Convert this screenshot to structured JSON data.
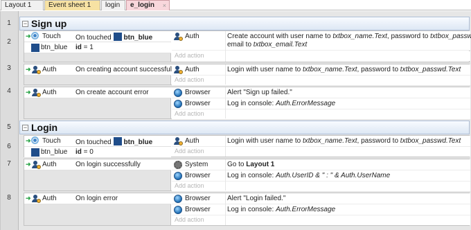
{
  "tabs": [
    {
      "label": "Layout 1"
    },
    {
      "label": "Event sheet 1"
    },
    {
      "label": "login"
    },
    {
      "label": "e_login",
      "close": "×"
    }
  ],
  "row_numbers": [
    "1",
    "2",
    "3",
    "4",
    "5",
    "6",
    "7",
    "8"
  ],
  "groups": [
    {
      "title": "Sign up",
      "toggle": "−"
    },
    {
      "title": "Login",
      "toggle": "−"
    }
  ],
  "common": {
    "add_action": "Add action",
    "on_touched": "On touched",
    "btn_blue": "btn_blue",
    "id_label": "id",
    "id_eq_1": "= 1",
    "id_eq_0": "= 0",
    "auth": "Auth",
    "browser": "Browser",
    "system": "System",
    "touch": "Touch"
  },
  "events": {
    "e2": {
      "cond2_obj": "btn_blue",
      "action": {
        "p1": "Create account with user name to ",
        "v1": "txtbox_name.Text",
        "p2": ", password to ",
        "v2": "txtbox_passwd.Text",
        "p3": ",",
        "p4": "email to ",
        "v3": "txtbox_email.Text"
      }
    },
    "e3": {
      "cond": "On creating account successfully",
      "action": {
        "p1": "Login with user name to ",
        "v1": "txtbox_name.Text",
        "p2": ", password to ",
        "v2": "txtbox_passwd.Text"
      }
    },
    "e4": {
      "cond": "On create account error",
      "a1": "Alert \"Sign up failed.\"",
      "a2_p": "Log in console: ",
      "a2_v": "Auth.ErrorMessage"
    },
    "e6": {
      "action": {
        "p1": "Login with user name to ",
        "v1": "txtbox_name.Text",
        "p2": ", password to ",
        "v2": "txtbox_passwd.Text"
      }
    },
    "e7": {
      "cond": "On login successfully",
      "a1_p": "Go to ",
      "a1_v": "Layout 1",
      "a2_p": "Log in console: ",
      "a2_v": "Auth.UserID & \" : \" & Auth.UserName"
    },
    "e8": {
      "cond": "On login error",
      "a1": "Alert \"Login failed.\"",
      "a2_p": "Log in console: ",
      "a2_v": "Auth.ErrorMessage"
    }
  }
}
